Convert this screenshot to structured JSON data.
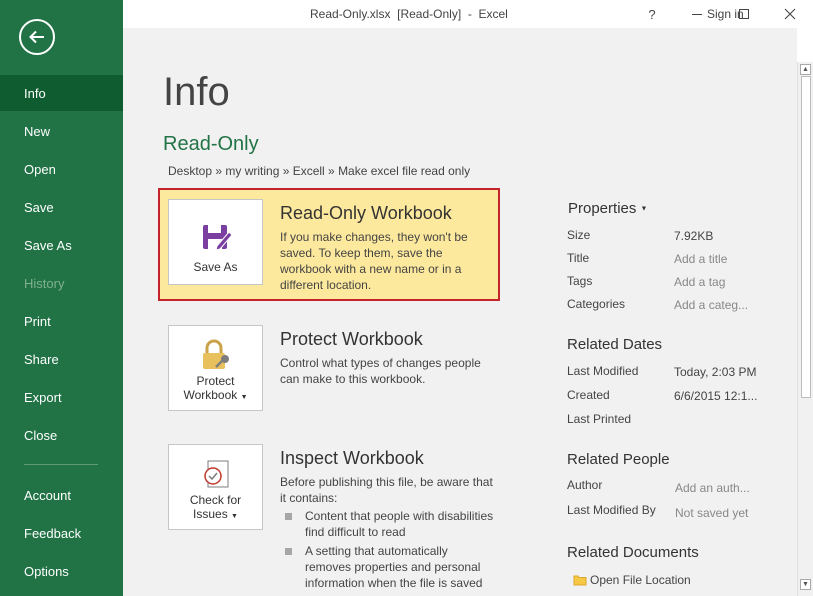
{
  "window": {
    "title": "Read-Only.xlsx  [Read-Only]  -  Excel",
    "sign_in": "Sign in",
    "help": "?",
    "minimize": "—",
    "maximize": "☐",
    "close": "✕"
  },
  "sidebar": {
    "items": [
      {
        "label": "Info",
        "state": "active"
      },
      {
        "label": "New"
      },
      {
        "label": "Open"
      },
      {
        "label": "Save"
      },
      {
        "label": "Save As"
      },
      {
        "label": "History",
        "state": "disabled"
      },
      {
        "label": "Print"
      },
      {
        "label": "Share"
      },
      {
        "label": "Export"
      },
      {
        "label": "Close"
      },
      {
        "label": "Account"
      },
      {
        "label": "Feedback"
      },
      {
        "label": "Options"
      }
    ]
  },
  "main": {
    "title": "Info",
    "file_name": "Read-Only",
    "breadcrumb": "Desktop » my writing » Excell » Make excel file read only",
    "read_only": {
      "button_label": "Save As",
      "title": "Read-Only Workbook",
      "description": "If you make changes, they won't be saved. To keep them, save the workbook with a new name or in a different location."
    },
    "protect": {
      "button_line1": "Protect",
      "button_line2": "Workbook",
      "title": "Protect Workbook",
      "description": "Control what types of changes people can make to this workbook."
    },
    "inspect": {
      "button_line1": "Check for",
      "button_line2": "Issues",
      "title": "Inspect Workbook",
      "description": "Before publishing this file, be aware that it contains:",
      "bullets": [
        "Content that people with disabilities find difficult to read",
        "A setting that automatically removes properties and personal information when the file is saved"
      ]
    }
  },
  "properties": {
    "header": "Properties",
    "size_label": "Size",
    "size_value": "7.92KB",
    "title_label": "Title",
    "title_value": "Add a title",
    "tags_label": "Tags",
    "tags_value": "Add a tag",
    "categories_label": "Categories",
    "categories_value": "Add a categ...",
    "related_dates_header": "Related Dates",
    "last_modified_label": "Last Modified",
    "last_modified_value": "Today, 2:03 PM",
    "created_label": "Created",
    "created_value": "6/6/2015 12:1...",
    "last_printed_label": "Last Printed",
    "related_people_header": "Related People",
    "author_label": "Author",
    "author_value": "Add an auth...",
    "last_modified_by_label": "Last Modified By",
    "last_modified_by_value": "Not saved yet",
    "related_documents_header": "Related Documents",
    "open_file_location": "Open File Location"
  },
  "colors": {
    "brand_green": "#217346",
    "active_nav": "#0e5c2f",
    "highlight_bg": "#fde99d",
    "highlight_border": "#c4232c"
  }
}
